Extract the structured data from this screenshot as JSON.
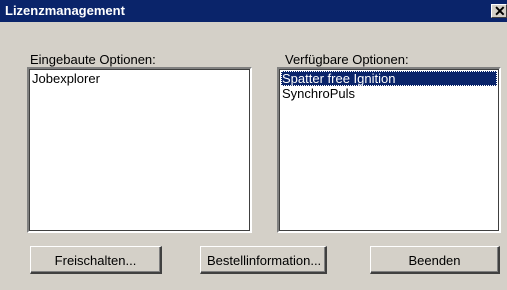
{
  "window": {
    "title": "Lizenzmanagement",
    "close_glyph": "✕"
  },
  "installed": {
    "label": "Eingebaute Optionen:",
    "items": [
      "Jobexplorer"
    ]
  },
  "available": {
    "label": "Verfügbare Optionen:",
    "items": [
      "Spatter free Ignition",
      "SynchroPuls"
    ],
    "selected_index": 0
  },
  "buttons": {
    "unlock": "Freischalten...",
    "order_info": "Bestellinformation...",
    "exit": "Beenden"
  },
  "colors": {
    "titlebar": "#0a246a",
    "face": "#d4d0c8",
    "selection": "#0a246a"
  }
}
